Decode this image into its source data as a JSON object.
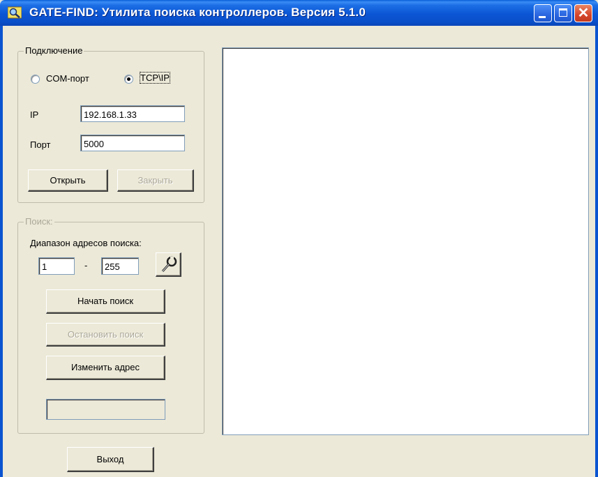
{
  "window": {
    "title": "GATE-FIND: Утилита поиска контроллеров. Версия 5.1.0",
    "colors": {
      "titlebar": "#0b55d4",
      "close": "#d5452a",
      "face": "#ece9d8"
    },
    "icons": {
      "app": "search-app-icon",
      "minimize": "minimize-icon",
      "maximize": "maximize-icon",
      "close": "close-icon"
    }
  },
  "connection": {
    "group_label": "Подключение",
    "com_label": "COM-порт",
    "tcp_label": "TCP\\IP",
    "selected": "TCP\\IP",
    "ip_label": "IP",
    "ip_value": "192.168.1.33",
    "port_label": "Порт",
    "port_value": "5000",
    "open_label": "Открыть",
    "close_label": "Закрыть"
  },
  "search": {
    "group_label": "Поиск:",
    "range_label": "Диапазон адресов поиска:",
    "range_from": "1",
    "range_sep": "-",
    "range_to": "255",
    "settings_icon": "wrench-icon",
    "start_label": "Начать поиск",
    "stop_label": "Остановить поиск",
    "change_label": "Изменить адрес",
    "status_value": ""
  },
  "footer": {
    "exit_label": "Выход"
  }
}
